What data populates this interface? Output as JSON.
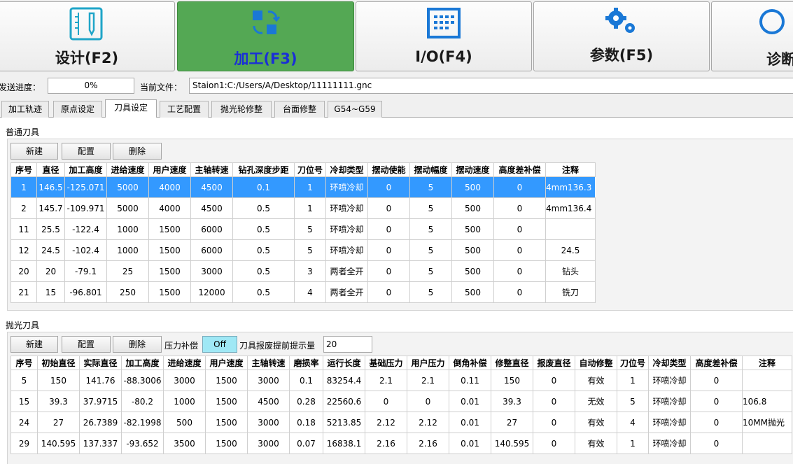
{
  "topbar": {
    "buttons": [
      {
        "label": "设计(F2)",
        "icon": "design-icon"
      },
      {
        "label": "加工(F3)",
        "icon": "machining-icon"
      },
      {
        "label": "I/O(F4)",
        "icon": "io-grid-icon"
      },
      {
        "label": "参数(F5)",
        "icon": "gears-icon"
      },
      {
        "label": "诊断",
        "icon": "diagnose-icon"
      }
    ],
    "active_index": 1,
    "active_color": "#54a854"
  },
  "status": {
    "progress_label": "发送进度：",
    "progress_value": "0%",
    "file_label": "当前文件：",
    "file_value": "Staion1:C:/Users/A/Desktop/11111111.gnc"
  },
  "tabs": [
    "加工轨迹",
    "原点设定",
    "刀具设定",
    "工艺配置",
    "抛光轮修整",
    "台面修整",
    "G54~G59"
  ],
  "active_tab": "刀具设定",
  "normal_tools": {
    "title": "普通刀具",
    "buttons": {
      "new": "新建",
      "config": "配置",
      "delete": "删除"
    },
    "columns": [
      "序号",
      "直径",
      "加工高度",
      "进给速度",
      "用户速度",
      "主轴转速",
      "钻孔深度步距",
      "刀位号",
      "冷却类型",
      "摆动使能",
      "摆动幅度",
      "摆动速度",
      "高度差补偿",
      "注释"
    ],
    "rows": [
      [
        "1",
        "146.5",
        "-125.071",
        "5000",
        "4000",
        "4500",
        "0.1",
        "1",
        "环喷冷却",
        "0",
        "5",
        "500",
        "0",
        "4mm136.3"
      ],
      [
        "2",
        "145.7",
        "-109.971",
        "5000",
        "4000",
        "4500",
        "0.5",
        "1",
        "环喷冷却",
        "0",
        "5",
        "500",
        "0",
        "4mm136.4"
      ],
      [
        "11",
        "25.5",
        "-122.4",
        "1000",
        "1500",
        "6000",
        "0.5",
        "5",
        "环喷冷却",
        "0",
        "5",
        "500",
        "0",
        ""
      ],
      [
        "12",
        "24.5",
        "-102.4",
        "1000",
        "1500",
        "6000",
        "0.5",
        "5",
        "环喷冷却",
        "0",
        "5",
        "500",
        "0",
        "24.5"
      ],
      [
        "20",
        "20",
        "-79.1",
        "25",
        "1500",
        "3000",
        "0.5",
        "3",
        "两者全开",
        "0",
        "5",
        "500",
        "0",
        "钻头"
      ],
      [
        "21",
        "15",
        "-96.801",
        "250",
        "1500",
        "12000",
        "0.5",
        "4",
        "两者全开",
        "0",
        "5",
        "500",
        "0",
        "铣刀"
      ]
    ],
    "selected_row": 0,
    "selection_color": "#3399ff"
  },
  "polish_tools": {
    "title": "抛光刀具",
    "buttons": {
      "new": "新建",
      "config": "配置",
      "delete": "删除"
    },
    "pressure_label": "压力补偿",
    "pressure_value": "Off",
    "warn_label": "刀具报废提前提示量",
    "warn_value": "20",
    "columns": [
      "序号",
      "初始直径",
      "实际直径",
      "加工高度",
      "进给速度",
      "用户速度",
      "主轴转速",
      "磨损率",
      "运行长度",
      "基础压力",
      "用户压力",
      "倒角补偿",
      "修整直径",
      "报废直径",
      "自动修整",
      "刀位号",
      "冷却类型",
      "高度差补偿",
      "注释"
    ],
    "rows": [
      [
        "5",
        "150",
        "141.76",
        "-88.3006",
        "3000",
        "1500",
        "3000",
        "0.1",
        "83254.4",
        "2.1",
        "2.1",
        "0.11",
        "150",
        "0",
        "有效",
        "1",
        "环喷冷却",
        "0",
        ""
      ],
      [
        "15",
        "39.3",
        "37.9715",
        "-80.2",
        "1000",
        "1500",
        "4500",
        "0.28",
        "22560.6",
        "0",
        "0",
        "0.01",
        "39.3",
        "0",
        "无效",
        "5",
        "环喷冷却",
        "0",
        "106.8"
      ],
      [
        "24",
        "27",
        "26.7389",
        "-82.1998",
        "500",
        "1500",
        "3000",
        "0.18",
        "5213.85",
        "2.12",
        "2.12",
        "0.01",
        "27",
        "0",
        "有效",
        "4",
        "环喷冷却",
        "0",
        "10MM抛光"
      ],
      [
        "29",
        "140.595",
        "137.337",
        "-93.652",
        "3500",
        "1500",
        "3000",
        "0.07",
        "16838.1",
        "2.16",
        "2.16",
        "0.01",
        "140.595",
        "0",
        "有效",
        "1",
        "环喷冷却",
        "0",
        ""
      ]
    ]
  }
}
